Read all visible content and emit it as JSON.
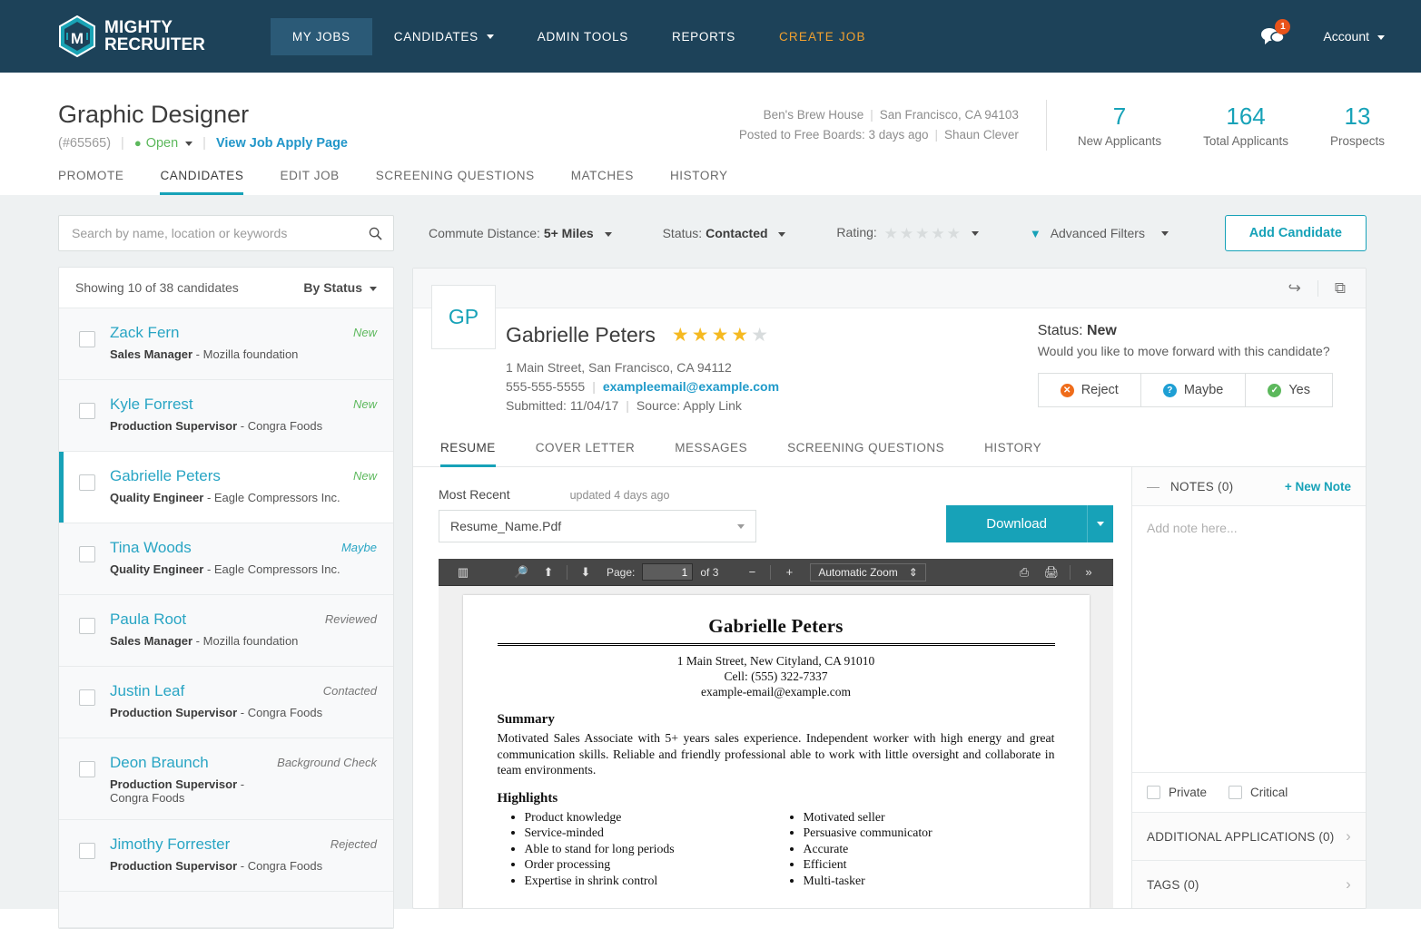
{
  "nav": {
    "brand_line1": "MIGHTY",
    "brand_line2": "RECRUITER",
    "items": [
      {
        "label": "MY JOBS",
        "active": true,
        "caret": false
      },
      {
        "label": "CANDIDATES",
        "active": false,
        "caret": true
      },
      {
        "label": "ADMIN TOOLS",
        "active": false,
        "caret": false
      },
      {
        "label": "REPORTS",
        "active": false,
        "caret": false
      },
      {
        "label": "CREATE  JOB",
        "active": false,
        "caret": false,
        "accent": true
      }
    ],
    "message_badge": "1",
    "account_label": "Account"
  },
  "job": {
    "title": "Graphic Designer",
    "id": "(#65565)",
    "status": "Open",
    "apply_page_link": "View Job Apply Page",
    "company": "Ben's Brew House",
    "location": "San Francisco, CA 94103",
    "posted": "Posted to Free Boards: 3 days ago",
    "owner": "Shaun Clever",
    "stats": [
      {
        "value": "7",
        "label": "New Applicants"
      },
      {
        "value": "164",
        "label": "Total Applicants"
      },
      {
        "value": "13",
        "label": "Prospects"
      }
    ]
  },
  "page_tabs": [
    {
      "label": "PROMOTE",
      "active": false
    },
    {
      "label": "CANDIDATES",
      "active": true
    },
    {
      "label": "EDIT JOB",
      "active": false
    },
    {
      "label": "SCREENING QUESTIONS",
      "active": false
    },
    {
      "label": "MATCHES",
      "active": false
    },
    {
      "label": "HISTORY",
      "active": false
    }
  ],
  "search": {
    "placeholder": "Search by name, location or keywords",
    "value": ""
  },
  "list": {
    "showing": "Showing 10 of 38 candidates",
    "sort_label": "By Status",
    "candidates": [
      {
        "name": "Zack Fern",
        "role": "Sales Manager",
        "company": "-  Mozilla foundation",
        "status": "New",
        "status_type": "new",
        "selected": false
      },
      {
        "name": "Kyle Forrest",
        "role": "Production Supervisor",
        "company": "- Congra Foods",
        "status": "New",
        "status_type": "new",
        "selected": false
      },
      {
        "name": "Gabrielle Peters",
        "role": "Quality Engineer",
        "company": "- Eagle Compressors Inc.",
        "status": "New",
        "status_type": "new",
        "selected": true
      },
      {
        "name": "Tina Woods",
        "role": "Quality Engineer",
        "company": "- Eagle Compressors Inc.",
        "status": "Maybe",
        "status_type": "maybe",
        "selected": false
      },
      {
        "name": "Paula Root",
        "role": "Sales Manager",
        "company": "-  Mozilla foundation",
        "status": "Reviewed",
        "status_type": "other",
        "selected": false
      },
      {
        "name": "Justin Leaf",
        "role": "Production Supervisor",
        "company": "- Congra Foods",
        "status": "Contacted",
        "status_type": "other",
        "selected": false
      },
      {
        "name": "Deon Braunch",
        "role": "Production Supervisor",
        "company": "- Congra Foods",
        "status": "Background Check",
        "status_type": "other",
        "selected": false
      },
      {
        "name": "Jimothy Forrester",
        "role": "Production Supervisor",
        "company": "- Congra Foods",
        "status": "Rejected",
        "status_type": "other",
        "selected": false
      }
    ]
  },
  "filters": {
    "commute_label": "Commute Distance:",
    "commute_value": "5+ Miles",
    "status_label": "Status:",
    "status_value": "Contacted",
    "rating_label": "Rating:",
    "rating_stars": 0,
    "advanced_label": "Advanced Filters",
    "add_candidate": "Add Candidate"
  },
  "candidate": {
    "initials": "GP",
    "name": "Gabrielle Peters",
    "rating": 4,
    "address": "1 Main Street, San Francisco, CA 94112",
    "phone": "555-555-5555",
    "email": "exampleemail@example.com",
    "submitted": "Submitted: 11/04/17",
    "source": "Source: Apply Link",
    "status_prefix": "Status:",
    "status_value": "New",
    "status_question": "Would you like to move forward with this candidate?",
    "actions": [
      {
        "label": "Reject",
        "icon": "reject-icon",
        "glyph": "✕"
      },
      {
        "label": "Maybe",
        "icon": "question-icon",
        "glyph": "?"
      },
      {
        "label": "Yes",
        "icon": "check-icon",
        "glyph": "✓"
      }
    ]
  },
  "content_tabs": [
    {
      "label": "RESUME",
      "active": true
    },
    {
      "label": "COVER LETTER",
      "active": false
    },
    {
      "label": "MESSAGES",
      "active": false
    },
    {
      "label": "SCREENING QUESTIONS",
      "active": false
    },
    {
      "label": "HISTORY",
      "active": false
    }
  ],
  "doc": {
    "most_recent_label": "Most Recent",
    "updated": "updated 4 days ago",
    "file_name": "Resume_Name.Pdf",
    "download_label": "Download"
  },
  "pdf_toolbar": {
    "page_label": "Page:",
    "page_value": "1",
    "page_of": "of 3",
    "zoom_value": "Automatic Zoom"
  },
  "resume": {
    "name": "Gabrielle Peters",
    "address": "1 Main Street, New Cityland, CA 91010",
    "cell": "Cell: (555) 322-7337",
    "email": "example-email@example.com",
    "summary_heading": "Summary",
    "summary_text": "Motivated Sales Associate with 5+ years sales experience. Independent worker with high energy and great communication skills. Reliable and friendly professional able to work with little oversight and collaborate in team environments.",
    "highlights_heading": "Highlights",
    "highlights_left": [
      "Product knowledge",
      "Service-minded",
      "Able to stand for long periods",
      "Order processing",
      "Expertise in shrink control"
    ],
    "highlights_right": [
      "Motivated seller",
      "Persuasive communicator",
      "Accurate",
      "Efficient",
      "Multi-tasker"
    ]
  },
  "notes": {
    "title": "NOTES (0)",
    "new_note": "+ New Note",
    "placeholder": "Add note here...",
    "private_label": "Private",
    "critical_label": "Critical",
    "additional_applications": "ADDITIONAL APPLICATIONS (0)",
    "tags": "TAGS (0)"
  },
  "colors": {
    "nav_bg": "#1d4259",
    "accent": "#17a2b8",
    "create_job": "#f0a030",
    "link": "#2196c9",
    "status_new": "#5eb95e",
    "star_on": "#f5b920"
  }
}
